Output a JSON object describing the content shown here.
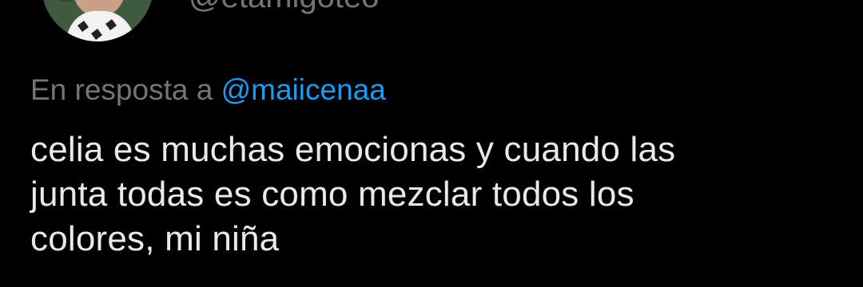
{
  "author": {
    "handle": "@etamigoteo"
  },
  "reply": {
    "prefix": "En resposta a",
    "mention": "@maiicenaa"
  },
  "tweet": {
    "lines": [
      "celia es muchas emocionas y cuando las",
      "junta todas es como mezclar todos los",
      "colores, mi niña"
    ]
  },
  "colors": {
    "background": "#000000",
    "text": "#e7e9ea",
    "muted": "#71767b",
    "link": "#1d9bf0"
  }
}
